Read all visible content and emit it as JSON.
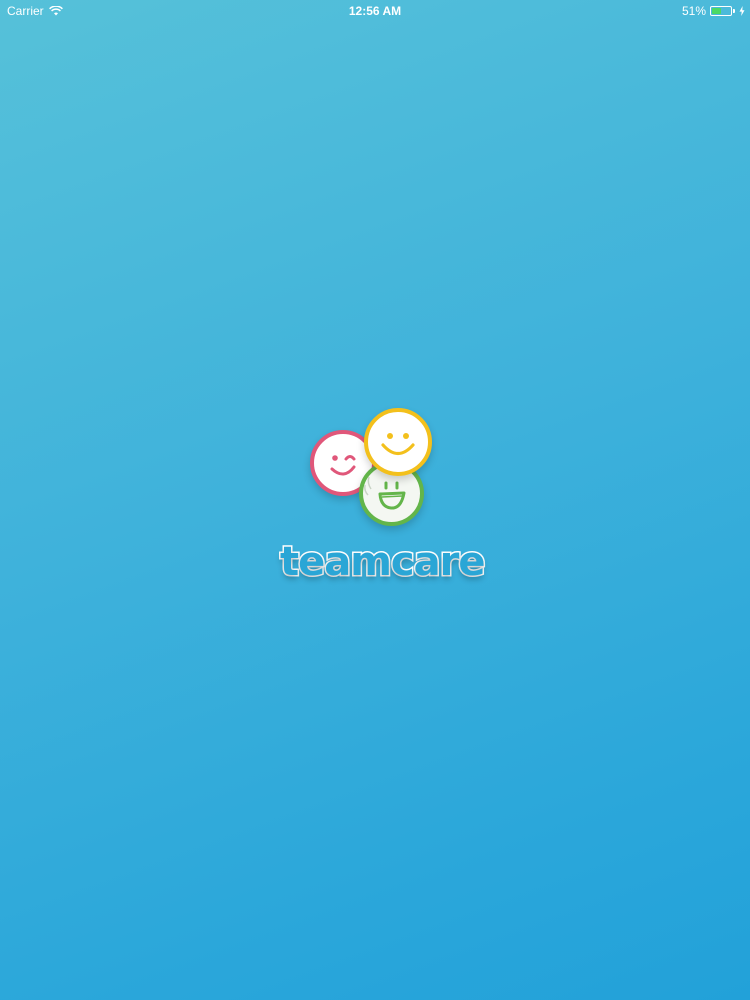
{
  "status_bar": {
    "carrier": "Carrier",
    "time": "12:56 AM",
    "battery_percent": "51%",
    "battery_level": 0.51,
    "battery_fill_color": "#4cd964",
    "icons": [
      "wifi-icon",
      "battery-icon",
      "charging-icon"
    ]
  },
  "splash": {
    "app_name": "teamcare",
    "background_colors": [
      "#56c1d9",
      "#22a1d9"
    ],
    "logo_colors": {
      "pink": "#e0577a",
      "yellow": "#f3c01c",
      "green": "#63b54a"
    },
    "icons": [
      "wink-smiley-icon",
      "smile-smiley-icon",
      "laugh-smiley-icon"
    ]
  }
}
